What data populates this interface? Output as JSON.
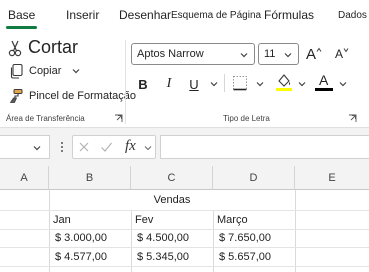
{
  "tabs": [
    {
      "label": "Base"
    },
    {
      "label": "Inserir"
    },
    {
      "label": "Desenhar"
    },
    {
      "label": "Esquema de Página"
    },
    {
      "label": "Fórmulas"
    },
    {
      "label": "Dados"
    }
  ],
  "ribbon": {
    "clipboard": {
      "cut_label": "Cortar",
      "copy_label": "Copiar",
      "painter_label": "Pincel de Formatação",
      "group_label": "Área de Transferência"
    },
    "font": {
      "font_name": "Aptos Narrow",
      "font_size": "11",
      "bold": "B",
      "italic": "I",
      "underline": "U",
      "font_color_letter": "A",
      "grow_letter": "A",
      "shrink_letter": "A",
      "group_label": "Tipo de Letra"
    },
    "colors": {
      "accent": "#107c41",
      "highlight": "#ffff00",
      "font_color": "#000000"
    }
  },
  "formula_bar": {
    "fx_label": "fx"
  },
  "sheet": {
    "columns": [
      "A",
      "B",
      "C",
      "D",
      "E"
    ],
    "title": "Vendas",
    "months": [
      "Jan",
      "Fev",
      "Março"
    ],
    "rows": [
      [
        "$ 3.000,00",
        "$ 4.500,00",
        "$ 7.650,00"
      ],
      [
        "$ 4.577,00",
        "$ 5.345,00",
        "$ 5.657,00"
      ]
    ]
  }
}
